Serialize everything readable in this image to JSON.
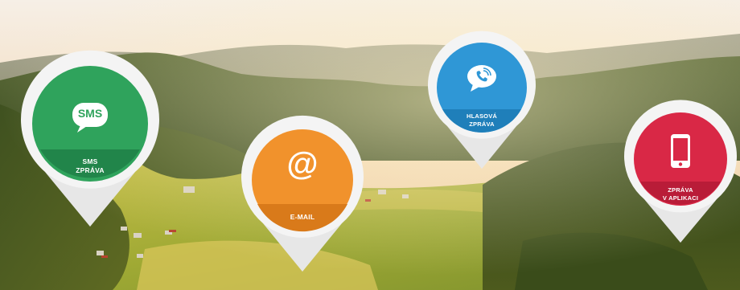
{
  "colors": {
    "sms": "#2fa35c",
    "email": "#f1922c",
    "voice": "#2f97d6",
    "app": "#d92846",
    "pin_body": "#f4f4f4"
  },
  "pins": {
    "sms": {
      "icon_text": "SMS",
      "label_line1": "SMS",
      "label_line2": "ZPRÁVA",
      "icon": "sms-bubble-icon"
    },
    "email": {
      "icon_text": "@",
      "label_line1": "E-MAIL",
      "icon": "at-sign-icon"
    },
    "voice": {
      "label_line1": "HLASOVÁ",
      "label_line2": "ZPRÁVA",
      "icon": "phone-bubble-icon"
    },
    "app": {
      "label_line1": "ZPRÁVA",
      "label_line2": "V APLIKACI",
      "icon": "smartphone-icon"
    }
  }
}
